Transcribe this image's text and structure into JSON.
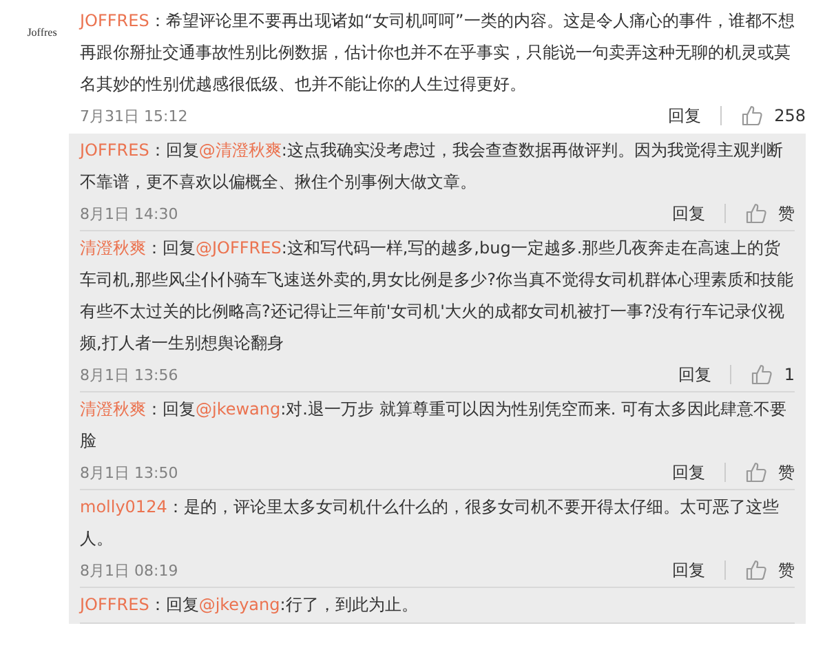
{
  "comment": {
    "avatar_text": "Joffres",
    "author": "JOFFRES",
    "separator": "：",
    "text": "希望评论里不要再出现诸如“女司机呵呵”一类的内容。这是令人痛心的事件，谁都不想再跟你掰扯交通事故性别比例数据，估计你也并不在乎事实，只能说一句卖弄这种无聊的机灵或莫名其妙的性别优越感很低级、也并不能让你的人生过得更好。",
    "time": "7月31日 15:12",
    "reply_label": "回复",
    "like_label": "258"
  },
  "replies": [
    {
      "author": "JOFFRES",
      "separator": "：",
      "prefix": "回复",
      "mention": "@清澄秋爽",
      "text": ":这点我确实没考虑过，我会查查数据再做评判。因为我觉得主观判断不靠谱，更不喜欢以偏概全、揪住个别事例大做文章。",
      "time": "8月1日 14:30",
      "reply_label": "回复",
      "like_label": "赞"
    },
    {
      "author": "清澄秋爽",
      "separator": "：",
      "prefix": "回复",
      "mention": "@JOFFRES",
      "text": ":这和写代码一样,写的越多,bug一定越多.那些几夜奔走在高速上的货车司机,那些风尘仆仆骑车飞速送外卖的,男女比例是多少?你当真不觉得女司机群体心理素质和技能有些不太过关的比例略高?还记得让三年前'女司机'大火的成都女司机被打一事?没有行车记录仪视频,打人者一生别想舆论翻身",
      "time": "8月1日 13:56",
      "reply_label": "回复",
      "like_label": "1"
    },
    {
      "author": "清澄秋爽",
      "separator": "：",
      "prefix": "回复",
      "mention": "@jkewang",
      "text": ":对.退一万步 就算尊重可以因为性别凭空而来. 可有太多因此肆意不要脸",
      "time": "8月1日 13:50",
      "reply_label": "回复",
      "like_label": "赞"
    },
    {
      "author": "molly0124",
      "separator": "：",
      "text": "是的，评论里太多女司机什么什么的，很多女司机不要开得太仔细。太可恶了这些人。",
      "time": "8月1日 08:19",
      "reply_label": "回复",
      "like_label": "赞"
    },
    {
      "author": "JOFFRES",
      "separator": "：",
      "prefix": "回复",
      "mention": "@jkeyang",
      "text": ":行了，到此为止。"
    }
  ]
}
